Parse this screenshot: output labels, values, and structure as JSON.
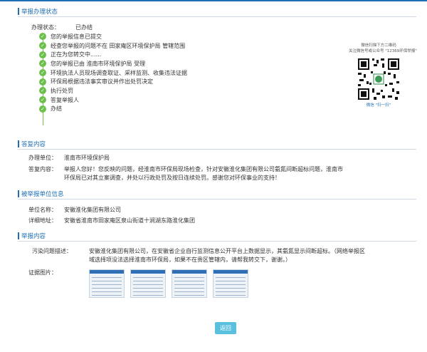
{
  "colors": {
    "accent": "#1f6fb5",
    "step_green": "#6cc04a",
    "button": "#5bc0de"
  },
  "status_section": {
    "title": "举报办理状态",
    "status_label": "办理状态：",
    "status_value": "已办结",
    "steps": [
      "您的举报信息已提交",
      "经查您举报的问题不在 田家庵区环境保护局 管辖范围",
      "正在为您转交中......",
      "您的举报已由 淮南市环境保护局 受理",
      "环境执法人员现场调查取证、采样监测、收集违法证据",
      "环保局根据违法事实审议并作出处罚决定",
      "执行处罚",
      "答复举报人",
      "办结"
    ]
  },
  "qr": {
    "caption_line1": "微信扫描下方二维码",
    "caption_line2": "关注微信号或公众号 \"12369环保举报\"",
    "bottom_label": "微信 \"扫一扫\""
  },
  "reply_section": {
    "title": "答复内容",
    "unit_label": "办理单位：",
    "unit_value": "淮南市环境保护局",
    "content_label": "答复内容：",
    "content_line1": "举报人您好！您反映的问题，经淮南市环保局现场检查，针对安徽淮化集团有限公司氨氮间断超标问题，淮南市",
    "content_line2": "环保局已对其立案调查，并处以行政处罚及按日连续处罚。感谢您对环保事业的支持！"
  },
  "reported_section": {
    "title": "被举报单位信息",
    "name_label": "单位名称：",
    "name_value": "安徽淮化集团有限公司",
    "address_label": "详细地址：",
    "address_value": "安徽省淮南市田家庵区泉山街道十涧湖东路淮化集团"
  },
  "report_section": {
    "title": "举报内容",
    "desc_label": "污染问题描述：",
    "desc_line1": "安徽淮化集团有限公司，在安徽省企业自行监测信息公开平台上数据显示，其氨氮显示间断超标。（网络举报区",
    "desc_line2": "域选择项没法选择淮南市环保局，如果不在贵区管辖内，请帮我转交下，谢谢。）",
    "evidence_label": "证据图片："
  },
  "back_button": "返回"
}
